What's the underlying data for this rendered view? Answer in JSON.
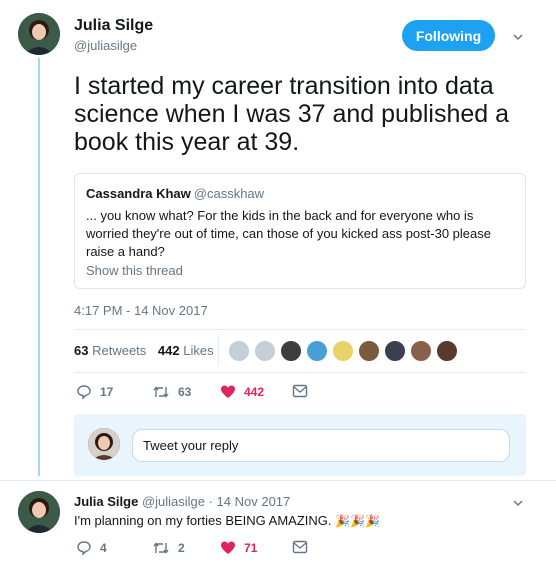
{
  "tweet": {
    "author_name": "Julia Silge",
    "author_handle": "@juliasilge",
    "follow_label": "Following",
    "text": "I started my career transition into data science when I was 37 and published a book this year at 39.",
    "timestamp": "4:17 PM - 14 Nov 2017",
    "retweets_count": "63",
    "retweets_label": "Retweets",
    "likes_count": "442",
    "likes_label": "Likes",
    "actions": {
      "replies": "17",
      "retweets": "63",
      "likes": "442"
    },
    "liked_heart_color": "#e0245e"
  },
  "quoted": {
    "name": "Cassandra Khaw",
    "handle": "@casskhaw",
    "text": "... you know what? For the kids in the back and for everyone who is worried they're out of time, can those of you kicked ass post-30 please raise a hand?",
    "show_thread": "Show this thread"
  },
  "reply_box": {
    "placeholder": "Tweet your reply"
  },
  "reply": {
    "author_name": "Julia Silge",
    "meta": "@juliasilge · 14 Nov 2017",
    "text": "I'm planning on my forties BEING AMAZING.",
    "emoji": "🎉🎉🎉",
    "actions": {
      "replies": "4",
      "retweets": "2",
      "likes": "71"
    }
  },
  "colors": {
    "accent": "#1da1f2",
    "like": "#e0245e",
    "muted": "#657786",
    "thread_line": "#a8d8f0"
  }
}
